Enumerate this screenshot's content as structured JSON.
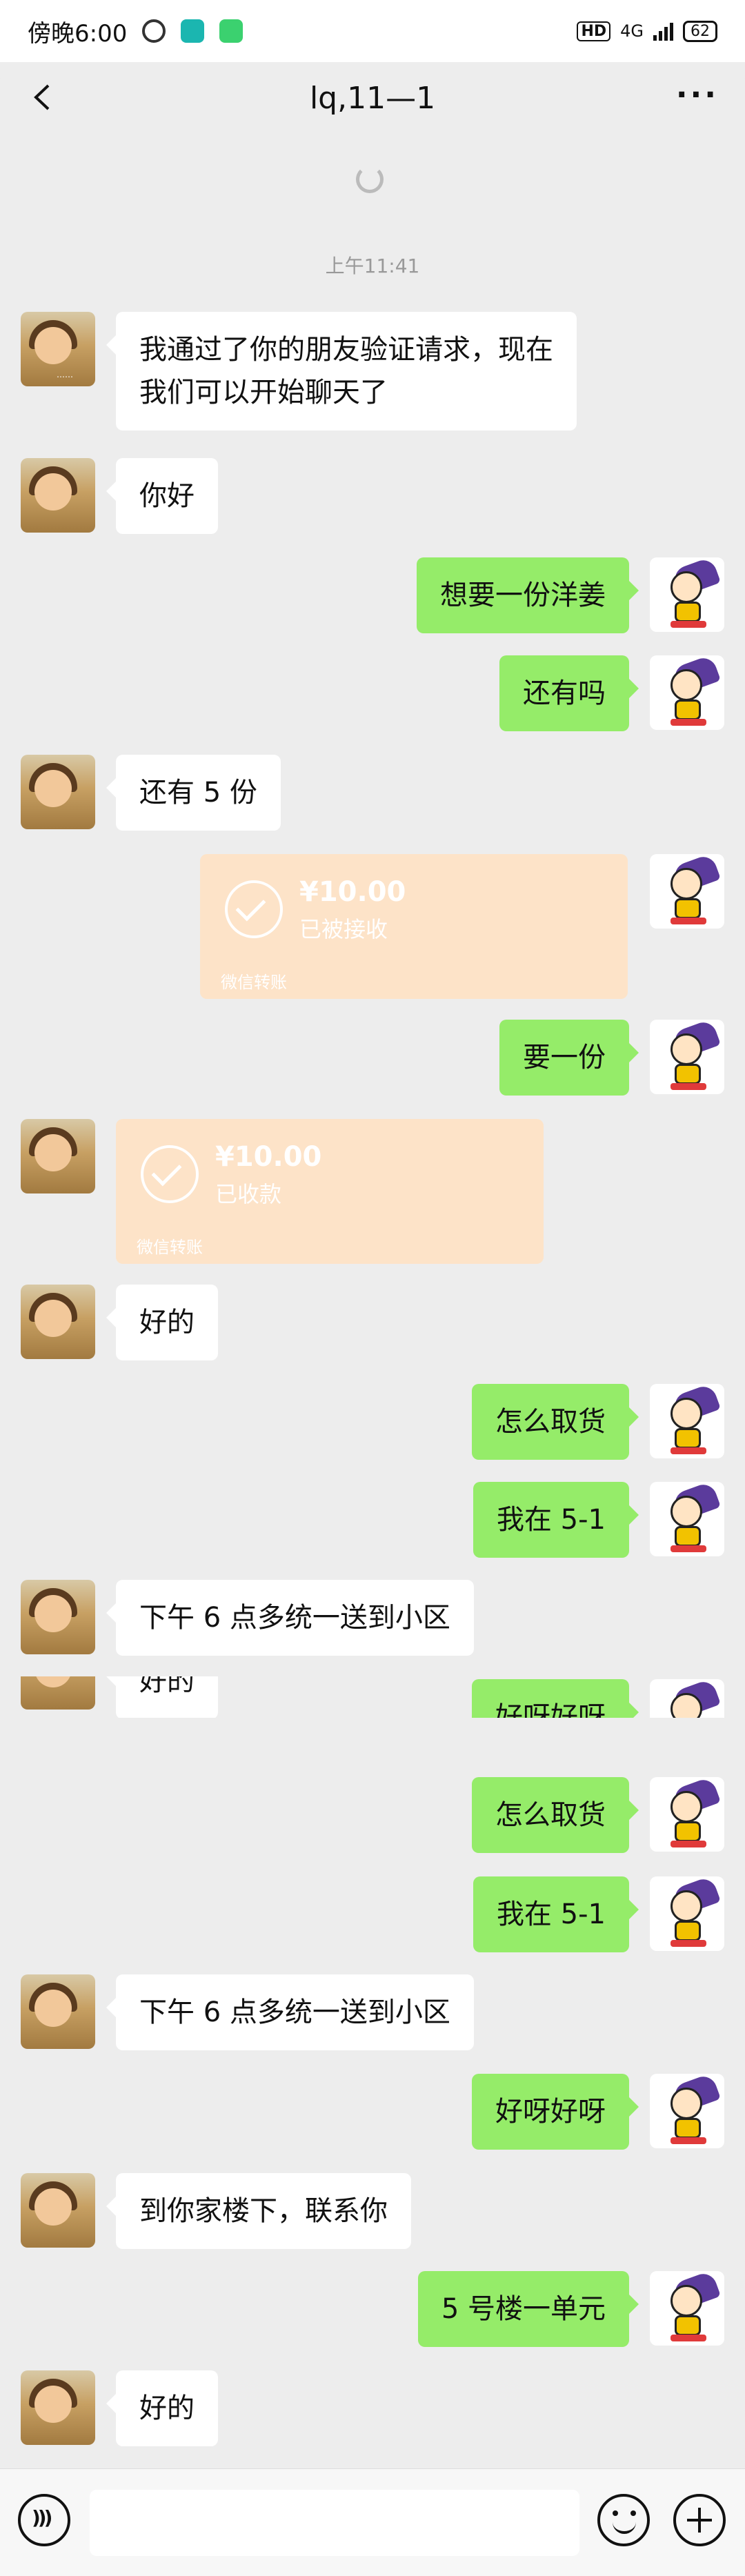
{
  "status_bar": {
    "time": "傍晚6:00",
    "hd": "HD",
    "network": "4G",
    "battery": "62"
  },
  "header": {
    "title": "lq,11—1",
    "more": "···"
  },
  "timestamp": "上午11:41",
  "messages": [
    {
      "text": "我通过了你的朋友验证请求，现在\n我们可以开始聊天了"
    },
    {
      "text": "你好"
    },
    {
      "text": "想要一份洋姜"
    },
    {
      "text": "还有吗"
    },
    {
      "text": "还有 5 份"
    },
    {
      "text": "要一份"
    },
    {
      "text": "好的"
    },
    {
      "text": "怎么取货"
    },
    {
      "text": "我在 5-1"
    },
    {
      "text": "下午 6 点多统一送到小区"
    },
    {
      "text": "怎么取货"
    },
    {
      "text": "我在 5-1"
    },
    {
      "text": "下午 6 点多统一送到小区"
    },
    {
      "text": "好呀好呀"
    },
    {
      "text": "到你家楼下，联系你"
    },
    {
      "text": "5 号楼一单元"
    },
    {
      "text": "好的"
    }
  ],
  "transfers": [
    {
      "amount": "¥10.00",
      "status": "已被接收",
      "footer": "微信转账"
    },
    {
      "amount": "¥10.00",
      "status": "已收款",
      "footer": "微信转账"
    }
  ],
  "glitch": {
    "out_text": "好呀好呀",
    "in_text": "好的"
  },
  "avatar_caption": "……",
  "colors": {
    "background": "#ededed",
    "outgoing_bubble": "#95ec69",
    "incoming_bubble": "#ffffff",
    "transfer_card": "#fde3c8"
  }
}
